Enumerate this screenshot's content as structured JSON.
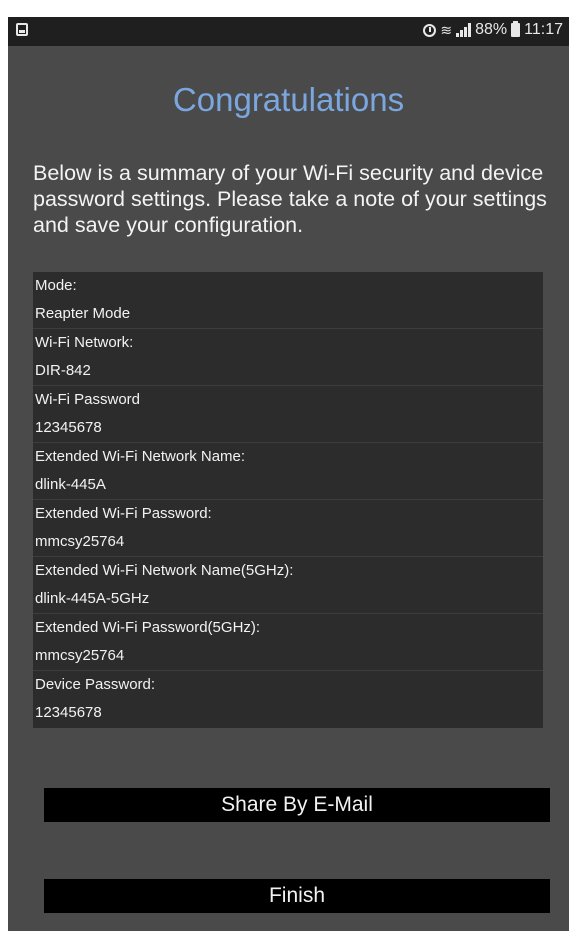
{
  "status_bar": {
    "battery": "88%",
    "time": "11:17",
    "icons": [
      "screenshot-icon",
      "alarm-icon",
      "wifi-icon",
      "signal-icon",
      "battery-icon"
    ]
  },
  "title": "Congratulations",
  "summary": "Below is a summary of your Wi-Fi security and device password settings. Please take a note of your settings and save your configuration.",
  "settings": [
    {
      "label": "Mode:",
      "value": "Reapter Mode"
    },
    {
      "label": "Wi-Fi Network:",
      "value": "DIR-842"
    },
    {
      "label": "Wi-Fi Password",
      "value": "12345678"
    },
    {
      "label": "Extended Wi-Fi Network Name:",
      "value": "dlink-445A"
    },
    {
      "label": "Extended Wi-Fi Password:",
      "value": "mmcsy25764"
    },
    {
      "label": "Extended Wi-Fi Network Name(5GHz):",
      "value": "dlink-445A-5GHz"
    },
    {
      "label": "Extended Wi-Fi Password(5GHz):",
      "value": "mmcsy25764"
    },
    {
      "label": "Device Password:",
      "value": "12345678"
    }
  ],
  "buttons": {
    "share": "Share By E-Mail",
    "finish": "Finish"
  },
  "colors": {
    "title": "#7aa7e0",
    "background": "#4a4a4a",
    "table": "#2c2c2c",
    "button": "#000000"
  }
}
